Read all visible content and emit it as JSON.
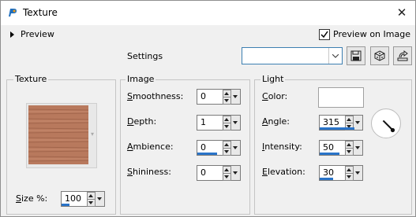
{
  "window": {
    "title": "Texture"
  },
  "preview": {
    "toggle_label": "Preview",
    "on_image_label": "Preview on Image",
    "on_image_checked": true
  },
  "settings": {
    "label": "Settings",
    "value": ""
  },
  "texture": {
    "group_label": "Texture",
    "size_label": "Size %:",
    "size_value": "100",
    "size_fraction": 0.2
  },
  "image": {
    "group_label": "Image",
    "rows": [
      {
        "label": "Smoothness:",
        "value": "0",
        "fraction": 0.0
      },
      {
        "label": "Depth:",
        "value": "1",
        "fraction": 0.0
      },
      {
        "label": "Ambience:",
        "value": "0",
        "fraction": 0.5
      },
      {
        "label": "Shininess:",
        "value": "0",
        "fraction": 0.0
      }
    ]
  },
  "light": {
    "group_label": "Light",
    "color_label": "Color:",
    "color": "#ffffff",
    "angle_label": "Angle:",
    "angle_value": "315",
    "angle_fraction": 0.875,
    "intensity_label": "Intensity:",
    "intensity_value": "50",
    "intensity_fraction": 0.5,
    "elevation_label": "Elevation:",
    "elevation_value": "30",
    "elevation_fraction": 0.33
  },
  "colors": {
    "accent": "#2a74c9",
    "texture_base": "#b8795d"
  }
}
